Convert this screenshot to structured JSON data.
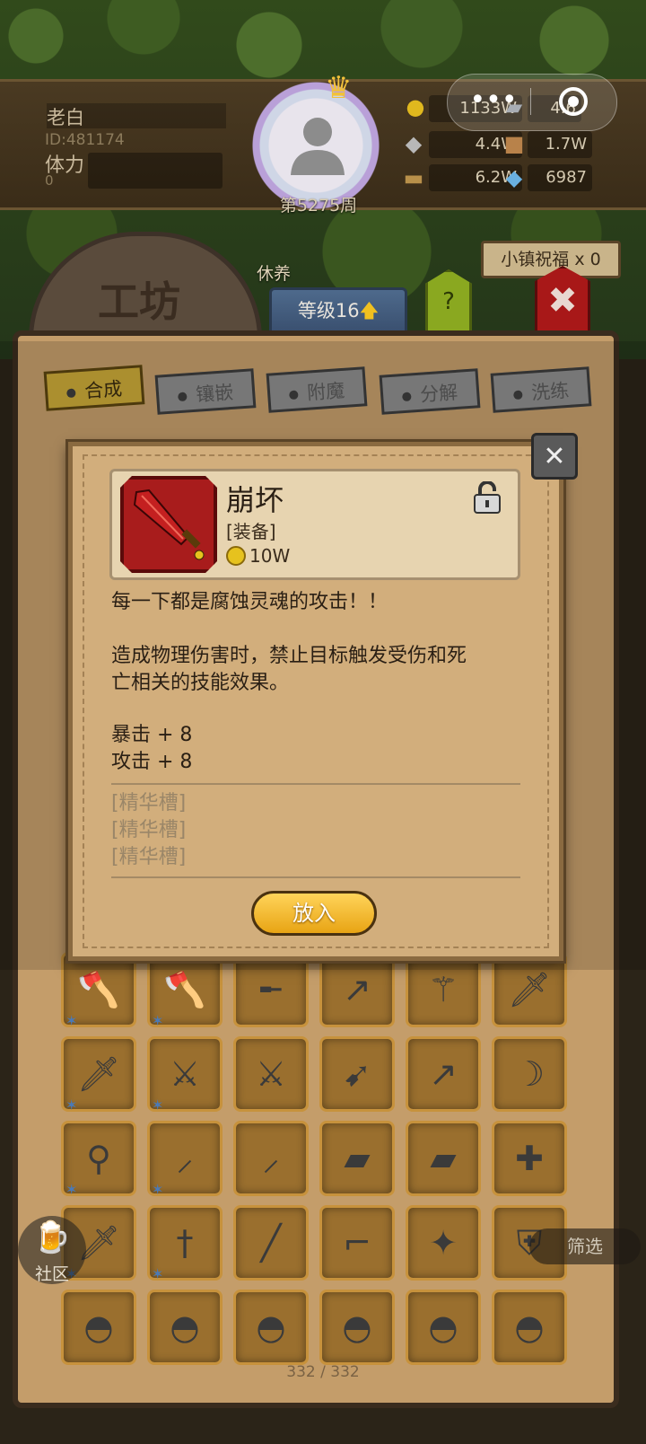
{
  "player": {
    "name": "老白",
    "id": "ID:481174",
    "stamina_label": "体力",
    "stamina_value": "0",
    "week": "第5275周"
  },
  "resources": [
    {
      "icon": "gold-coin-icon",
      "value": "1133W"
    },
    {
      "icon": "iron-ingot-icon",
      "value": "4.6"
    },
    {
      "icon": "ore-icon",
      "value": "4.4W"
    },
    {
      "icon": "leather-icon",
      "value": "1.7W"
    },
    {
      "icon": "wood-log-icon",
      "value": "6.2W"
    },
    {
      "icon": "crystal-icon",
      "value": "6987"
    }
  ],
  "capsule": {
    "more": "•••"
  },
  "header": {
    "workshop_title": "工坊",
    "rest_label": "休养",
    "level_label": "等级16",
    "help_label": "?",
    "blessing_label": "小镇祝福 x 0"
  },
  "tabs": [
    {
      "label": "合成",
      "active": true
    },
    {
      "label": "镶嵌",
      "active": false
    },
    {
      "label": "附魔",
      "active": false
    },
    {
      "label": "分解",
      "active": false
    },
    {
      "label": "洗练",
      "active": false
    }
  ],
  "item": {
    "name": "崩坏",
    "type": "[装备]",
    "price": "10W",
    "flavor": "每一下都是腐蚀灵魂的攻击！！",
    "effect_line1": "造成物理伤害时，禁止目标触发受伤和死",
    "effect_line2": "亡相关的技能效果。",
    "stat1": "暴击 + 8",
    "stat2": "攻击 + 8",
    "slots": [
      "[精华槽]",
      "[精华槽]",
      "[精华槽]"
    ],
    "put_in_label": "放入"
  },
  "inventory_rows": [
    [
      "axe-icon",
      "axe-icon",
      "rifle-icon",
      "spear-icon",
      "staff-icon",
      "dark-sword-icon"
    ],
    [
      "dark-sword-icon",
      "crossed-blades-icon",
      "crossed-blades-icon",
      "crossbow-icon",
      "spear-icon",
      "scythe-icon"
    ],
    [
      "orb-staff-icon",
      "curved-blade-icon",
      "curved-blade-icon",
      "cleaver-icon",
      "cleaver-icon",
      "medkit-icon"
    ],
    [
      "broadsword-icon",
      "dagger-icon",
      "katana-icon",
      "pistol-icon",
      "scepter-icon",
      "winged-shield-icon"
    ],
    [
      "helmet-icon",
      "helmet-icon",
      "helmet-icon",
      "helmet-icon",
      "helmet-icon",
      "helmet-icon"
    ]
  ],
  "footer": {
    "community_label": "社区",
    "filter_label": "筛选",
    "count": "332 / 332"
  },
  "colors": {
    "active_tab": "#c9a838",
    "item_frame": "#a81c1c",
    "button_gold": "#e8a414"
  }
}
